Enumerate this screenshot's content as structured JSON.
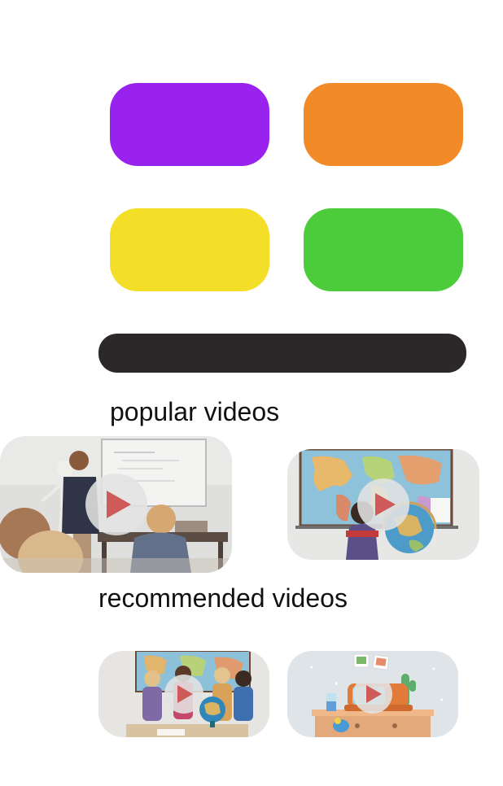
{
  "colors": {
    "tile_purple": "#9a22ee",
    "tile_orange": "#f28a27",
    "tile_yellow": "#f3de28",
    "tile_green": "#4ccc3b",
    "search_bar": "#2c2829",
    "play_button": "#e2e2e2",
    "play_triangle": "#cf5a5a"
  },
  "categories": {
    "tiles": [
      {
        "name": "purple-category-tile",
        "label": ""
      },
      {
        "name": "orange-category-tile",
        "label": ""
      },
      {
        "name": "yellow-category-tile",
        "label": ""
      },
      {
        "name": "green-category-tile",
        "label": ""
      }
    ]
  },
  "search": {
    "placeholder": ""
  },
  "popular": {
    "heading": "popular videos",
    "videos": [
      {
        "scene": "classroom-skeleton-teacher",
        "icon": "play-icon"
      },
      {
        "scene": "child-with-globe-world-map",
        "icon": "play-icon"
      }
    ]
  },
  "recommended": {
    "heading": "recommended videos",
    "videos": [
      {
        "scene": "children-around-globe",
        "icon": "play-icon"
      },
      {
        "scene": "toy-shelf-room",
        "icon": "play-icon"
      }
    ]
  }
}
